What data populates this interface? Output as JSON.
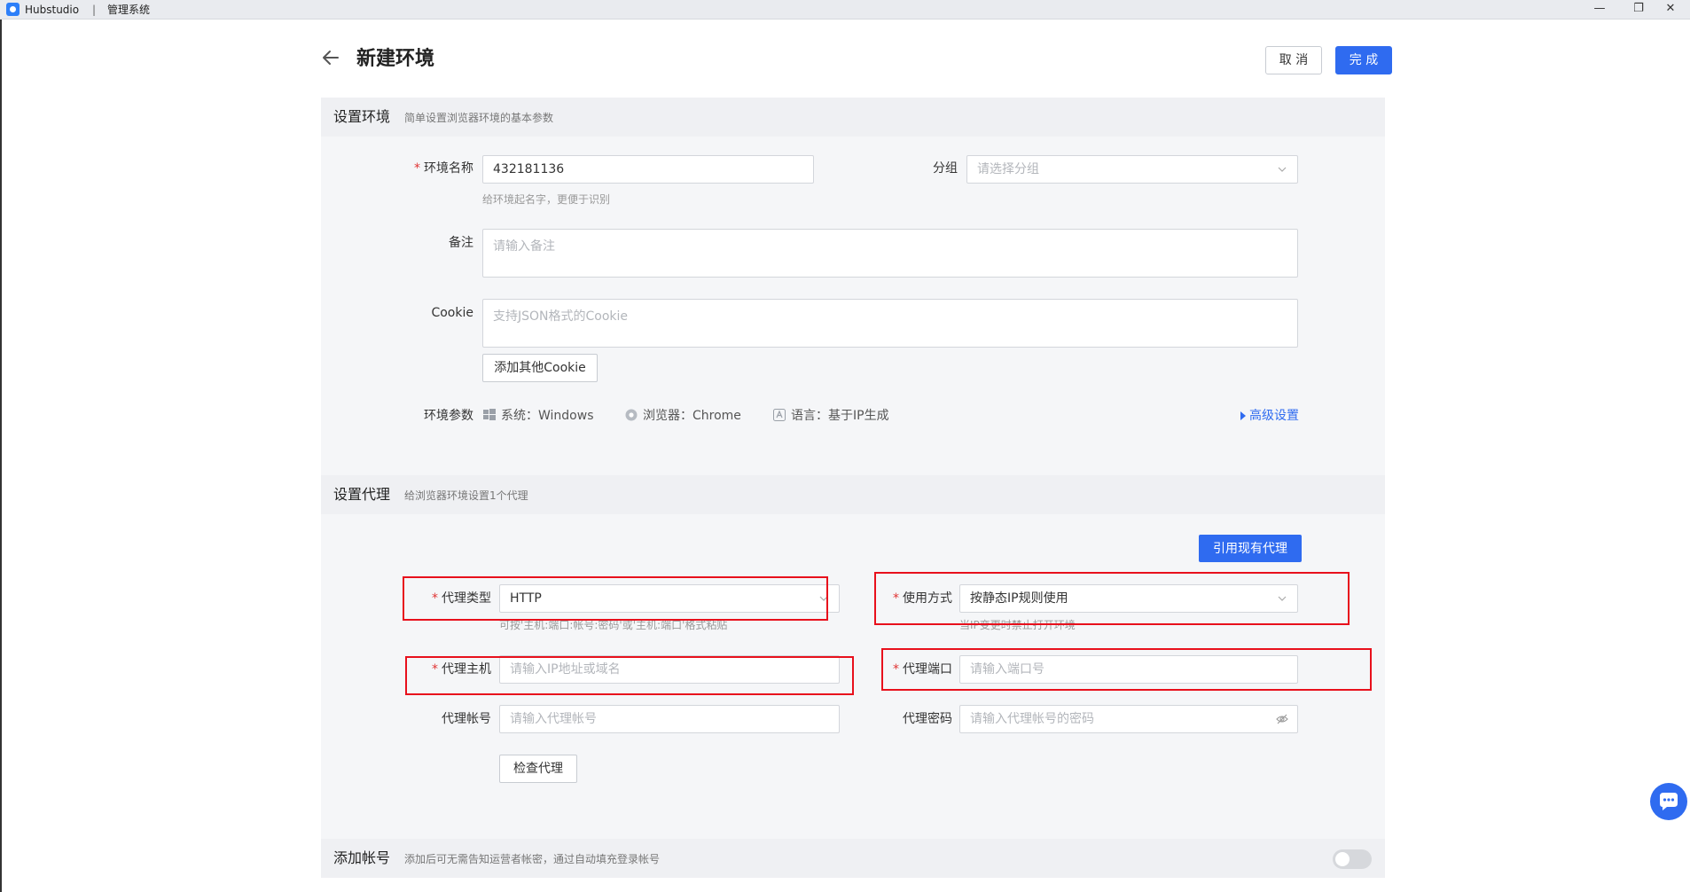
{
  "window": {
    "app_name": "Hubstudio",
    "separator": "|",
    "subtitle": "管理系统",
    "controls": {
      "minimize": "—",
      "restore": "❐",
      "close": "✕"
    }
  },
  "header": {
    "title": "新建环境",
    "cancel_label": "取 消",
    "done_label": "完 成"
  },
  "env_section": {
    "title": "设置环境",
    "subtitle": "简单设置浏览器环境的基本参数",
    "name_label": "环境名称",
    "name_value": "432181136",
    "name_hint": "给环境起名字，更便于识别",
    "group_label": "分组",
    "group_placeholder": "请选择分组",
    "remark_label": "备注",
    "remark_placeholder": "请输入备注",
    "cookie_label": "Cookie",
    "cookie_placeholder": "支持JSON格式的Cookie",
    "add_cookie_label": "添加其他Cookie",
    "params_label": "环境参数",
    "param_system": "系统：Windows",
    "param_browser": "浏览器：Chrome",
    "param_language": "语言：基于IP生成",
    "advanced_label": "高级设置"
  },
  "proxy_section": {
    "title": "设置代理",
    "subtitle": "给浏览器环境设置1个代理",
    "use_existing_label": "引用现有代理",
    "type_label": "代理类型",
    "type_value": "HTTP",
    "type_hint": "可按'主机:端口:帐号:密码'或'主机:端口'格式粘贴",
    "usage_label": "使用方式",
    "usage_value": "按静态IP规则使用",
    "usage_hint": "当IP变更时禁止打开环境",
    "host_label": "代理主机",
    "host_placeholder": "请输入IP地址或域名",
    "port_label": "代理端口",
    "port_placeholder": "请输入端口号",
    "account_label": "代理帐号",
    "account_placeholder": "请输入代理帐号",
    "password_label": "代理密码",
    "password_placeholder": "请输入代理帐号的密码",
    "check_label": "检查代理"
  },
  "account_section": {
    "title": "添加帐号",
    "subtitle": "添加后可无需告知运营者帐密，通过自动填充登录帐号",
    "toggle_on": false
  },
  "colors": {
    "primary": "#2f6bf0",
    "required": "#e03434",
    "annotation": "#e8101c"
  }
}
